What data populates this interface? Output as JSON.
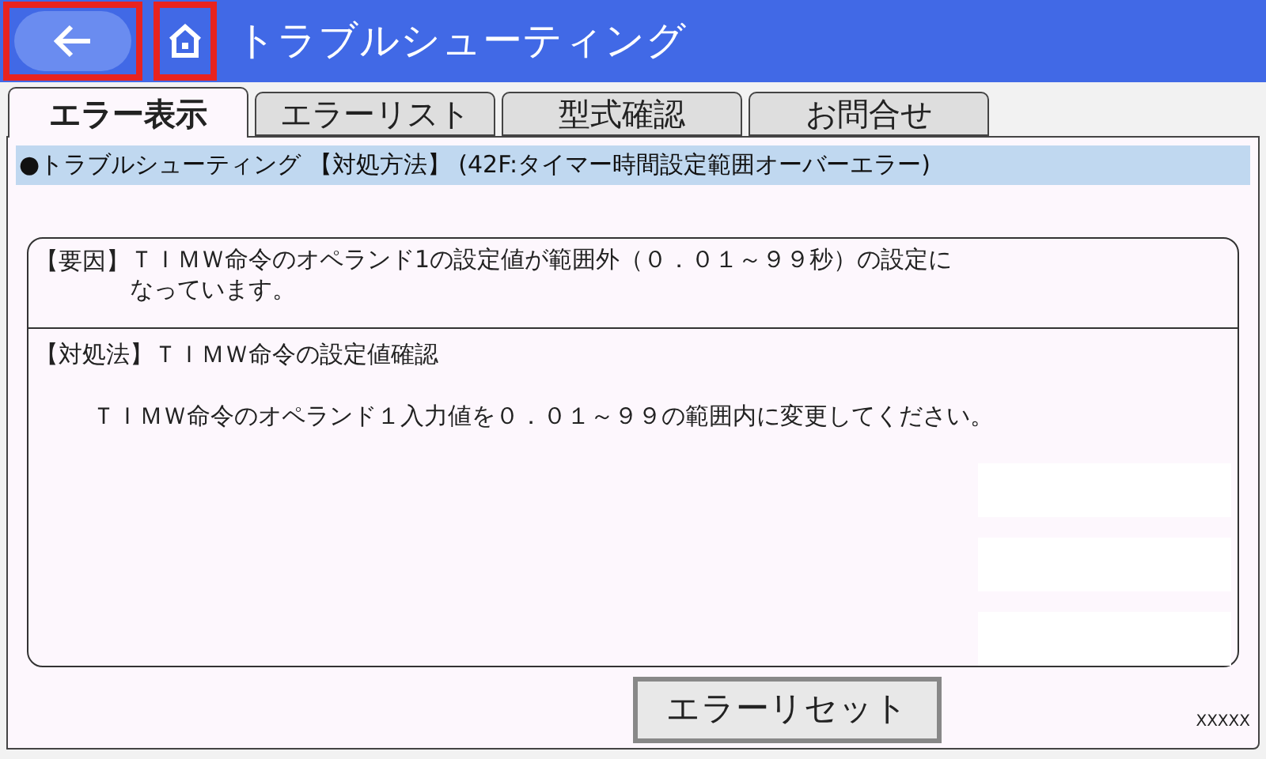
{
  "header": {
    "title": "トラブルシューティング",
    "back_button": {
      "highlighted": true
    },
    "home_button": {
      "highlighted": true
    }
  },
  "tabs": [
    {
      "label": "エラー表示",
      "selected": true
    },
    {
      "label": "エラーリスト",
      "selected": false
    },
    {
      "label": "型式確認",
      "selected": false
    },
    {
      "label": "お問合せ",
      "selected": false
    }
  ],
  "info_bar": "●トラブルシューティング 【対処方法】 (42F:タイマー時間設定範囲オーバーエラー)",
  "cause": {
    "label": "【要因】",
    "lines": [
      "ＴＩＭＷ命令のオペランド1の設定値が範囲外（０．０１～９９秒）の設定に",
      "なっています。"
    ]
  },
  "remedy": {
    "label": "【対処法】",
    "title": "ＴＩＭＷ命令の設定値確認",
    "text": "ＴＩＭＷ命令のオペランド１入力値を０．０１～９９の範囲内に変更してください。"
  },
  "reset_button": "エラーリセット",
  "code": "XXXXX"
}
